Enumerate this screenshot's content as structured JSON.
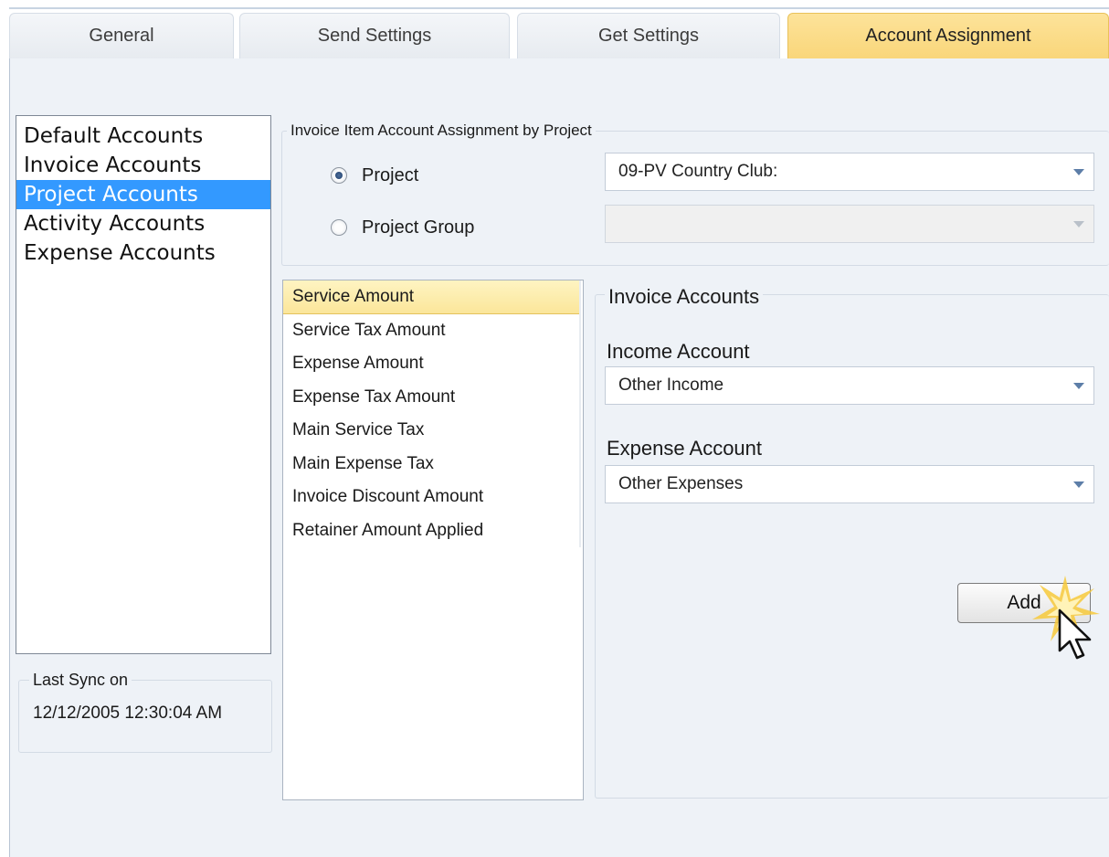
{
  "tabs": [
    {
      "label": "General",
      "active": false
    },
    {
      "label": "Send Settings",
      "active": false
    },
    {
      "label": "Get Settings",
      "active": false
    },
    {
      "label": "Account Assignment",
      "active": true
    }
  ],
  "nav": {
    "items": [
      "Default Accounts",
      "Invoice Accounts",
      "Project Accounts",
      "Activity Accounts",
      "Expense Accounts"
    ],
    "selected": "Project Accounts"
  },
  "sync": {
    "legend": "Last Sync on",
    "value": "12/12/2005 12:30:04 AM"
  },
  "assignment": {
    "legend": "Invoice Item Account Assignment by Project",
    "project_label": "Project",
    "project_value": "09-PV Country Club:",
    "project_group_label": "Project Group",
    "project_group_value": "",
    "selected_option": "Project"
  },
  "items": {
    "list": [
      "Service Amount",
      "Service Tax Amount",
      "Expense Amount",
      "Expense Tax Amount",
      "Main Service Tax",
      "Main Expense Tax",
      "Invoice Discount Amount",
      "Retainer Amount Applied"
    ],
    "selected": "Service Amount"
  },
  "accounts": {
    "legend": "Invoice Accounts",
    "income_label": "Income Account",
    "income_value": "Other Income",
    "expense_label": "Expense Account",
    "expense_value": "Other Expenses",
    "add_label": "Add"
  },
  "icons": {
    "cursor": "mouse-pointer-icon",
    "click": "click-burst-icon",
    "dropdown": "chevron-down-icon"
  },
  "colors": {
    "active_tab": "#f9d67a",
    "nav_selection": "#3399ff",
    "item_selection": "#fbe69a",
    "panel_bg": "#eef2f7"
  }
}
